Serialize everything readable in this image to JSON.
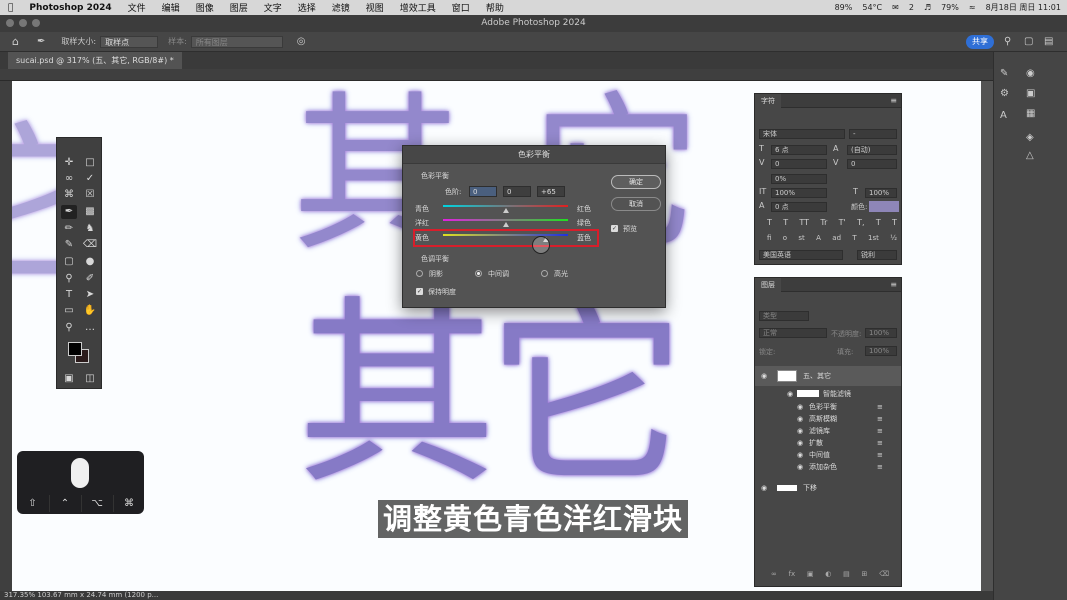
{
  "menubar": {
    "app": "Photoshop 2024",
    "items": [
      "文件",
      "编辑",
      "图像",
      "图层",
      "文字",
      "选择",
      "滤镜",
      "视图",
      "增效工具",
      "窗口",
      "帮助"
    ],
    "status": {
      "battery_pct": "89%",
      "temp": "54°C",
      "messages": "2",
      "wifi_pct": "79%",
      "datetime": "8月18日 周日 11:01"
    }
  },
  "window": {
    "title": "Adobe Photoshop 2024"
  },
  "options_bar": {
    "sample_size_label": "取样大小:",
    "sample_size_value": "取样点",
    "sample_label": "样本:",
    "sample_value": "所有图层",
    "share": "共享"
  },
  "document_tab": {
    "label": "sucai.psd @ 317% (五、其它, RGB/8#) *"
  },
  "canvas": {
    "glyphs_top": "其",
    "glyphs_top2": "它",
    "glyphs_bottom": "其它"
  },
  "status_bar": {
    "text": "317.35%    103.67 mm x 24.74 mm (1200 p..."
  },
  "subtitle": "调整黄色青色洋红滑块",
  "dialog": {
    "title": "色彩平衡",
    "section1": "色彩平衡",
    "levels_label": "色阶:",
    "levels": [
      "0",
      "0",
      "+65"
    ],
    "sliders": [
      {
        "left": "青色",
        "right": "红色",
        "value": 0
      },
      {
        "left": "洋红",
        "right": "绿色",
        "value": 0
      },
      {
        "left": "黄色",
        "right": "蓝色",
        "value": 65
      }
    ],
    "section2": "色调平衡",
    "tones": [
      "阴影",
      "中间调",
      "高光"
    ],
    "selected_tone": "中间调",
    "preserve": "保持明度",
    "ok": "确定",
    "cancel": "取消",
    "preview": "预览"
  },
  "char_panel": {
    "tab": "字符",
    "font": "宋体",
    "style": "-",
    "size": "6 点",
    "leading": "(自动)",
    "kerning": "0",
    "tracking": "0",
    "tsume": "0%",
    "vscale": "100%",
    "hscale": "100%",
    "baseline": "0 点",
    "color_label": "颜色:",
    "language": "美国英语",
    "aa": "锐利",
    "styles": [
      "T",
      "T",
      "TT",
      "Tr",
      "T'",
      "T,",
      "T",
      "T"
    ],
    "ot": [
      "fi",
      "o",
      "st",
      "A",
      "ad",
      "T",
      "1st",
      "½"
    ]
  },
  "layers_panel": {
    "tab": "图层",
    "search": "类型",
    "blend": "正常",
    "opacity_label": "不透明度:",
    "opacity": "100%",
    "lock_label": "锁定:",
    "fill_label": "填充:",
    "fill": "100%",
    "layers": [
      {
        "name": "五、其它",
        "type": "smart"
      },
      {
        "name": "智能滤镜",
        "type": "header"
      },
      {
        "name": "色彩平衡",
        "type": "filter"
      },
      {
        "name": "高斯模糊",
        "type": "filter"
      },
      {
        "name": "滤镜库",
        "type": "filter"
      },
      {
        "name": "扩散",
        "type": "filter"
      },
      {
        "name": "中间值",
        "type": "filter"
      },
      {
        "name": "添加杂色",
        "type": "filter"
      },
      {
        "name": "下移",
        "type": "normal"
      }
    ]
  },
  "colors": {
    "accent": "#2f6fd6",
    "highlight": "#d81e2b",
    "glyph": "#7a6cc0"
  }
}
